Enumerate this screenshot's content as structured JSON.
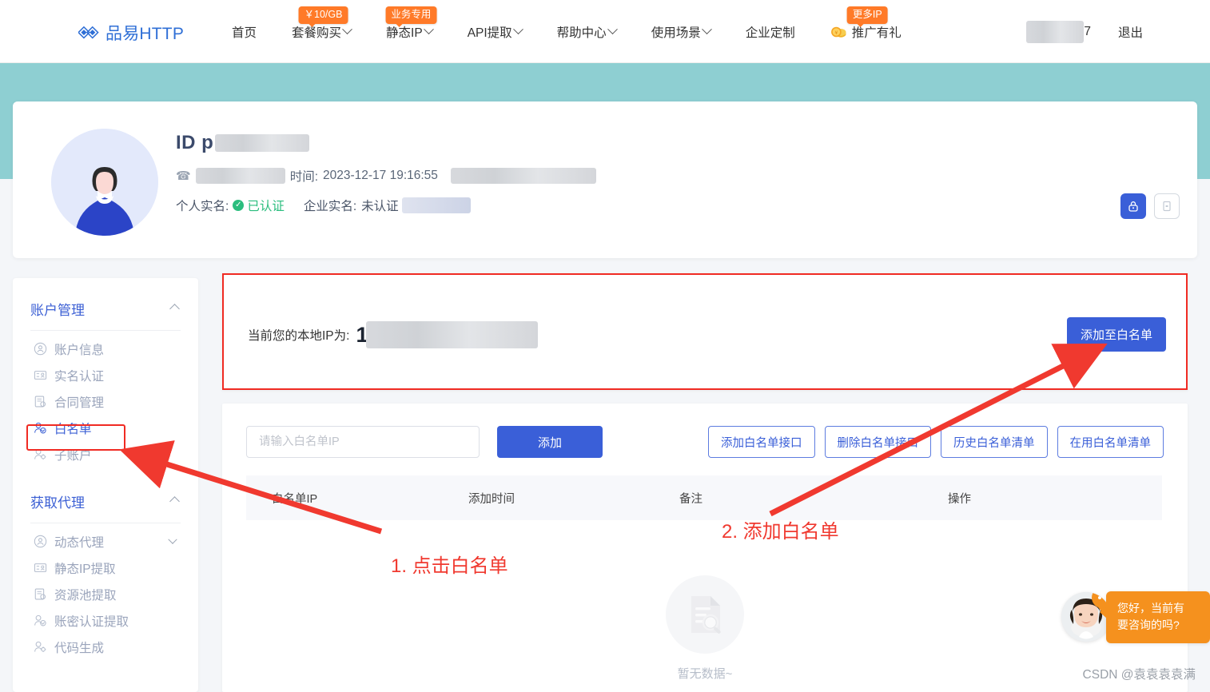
{
  "nav": {
    "logo_text": "品易HTTP",
    "items": [
      {
        "label": "首页",
        "caret": false,
        "badge": null
      },
      {
        "label": "套餐购买",
        "caret": true,
        "badge": "￥10/GB"
      },
      {
        "label": "静态IP",
        "caret": true,
        "badge": "业务专用"
      },
      {
        "label": "API提取",
        "caret": true,
        "badge": null
      },
      {
        "label": "帮助中心",
        "caret": true,
        "badge": null
      },
      {
        "label": "使用场景",
        "caret": true,
        "badge": null
      },
      {
        "label": "企业定制",
        "caret": false,
        "badge": null
      },
      {
        "label": "推广有礼",
        "caret": false,
        "badge": "更多IP",
        "icon": "coin-icon"
      }
    ],
    "user_suffix": "7",
    "logout_label": "退出"
  },
  "profile": {
    "id_prefix": "ID p",
    "register_label": "时间:",
    "register_time": "2023-12-17 19:16:55",
    "personal_label": "个人实名:",
    "personal_status": "已认证",
    "company_label": "企业实名:",
    "company_status": "未认证",
    "action_lock_icon": "lock-icon",
    "action_device_icon": "device-icon"
  },
  "sidebar": {
    "groups": [
      {
        "title": "账户管理",
        "collapse_icon": "chevron-up-icon",
        "items": [
          {
            "label": "账户信息",
            "icon": "user-circle-icon",
            "active": false,
            "sub": false
          },
          {
            "label": "实名认证",
            "icon": "id-card-icon",
            "active": false,
            "sub": false
          },
          {
            "label": "合同管理",
            "icon": "contract-icon",
            "active": false,
            "sub": false
          },
          {
            "label": "白名单",
            "icon": "user-check-icon",
            "active": true,
            "sub": false
          },
          {
            "label": "子账户",
            "icon": "user-gear-icon",
            "active": false,
            "sub": false
          }
        ]
      },
      {
        "title": "获取代理",
        "collapse_icon": "chevron-up-icon",
        "items": [
          {
            "label": "动态代理",
            "icon": "user-circle-icon",
            "active": false,
            "sub": true
          },
          {
            "label": "静态IP提取",
            "icon": "id-card-icon",
            "active": false,
            "sub": false
          },
          {
            "label": "资源池提取",
            "icon": "contract-icon",
            "active": false,
            "sub": false
          },
          {
            "label": "账密认证提取",
            "icon": "user-check-icon",
            "active": false,
            "sub": false
          },
          {
            "label": "代码生成",
            "icon": "user-gear-icon",
            "active": false,
            "sub": false
          }
        ]
      }
    ]
  },
  "ip_panel": {
    "label": "当前您的本地IP为:",
    "value_visible": "1",
    "add_button": "添加至白名单"
  },
  "whitelist": {
    "input_placeholder": "请输入白名单IP",
    "input_value": "",
    "add_button": "添加",
    "tool_buttons": [
      "添加白名单接口",
      "删除白名单接口",
      "历史白名单清单",
      "在用白名单清单"
    ],
    "columns": [
      "白名单IP",
      "添加时间",
      "备注",
      "操作"
    ],
    "rows": [],
    "empty_text": "暂无数据~"
  },
  "annotations": [
    {
      "text": "1. 点击白名单"
    },
    {
      "text": "2. 添加白名单"
    }
  ],
  "chat": {
    "message_line1": "您好，当前有",
    "message_line2": "要咨询的吗?"
  },
  "watermark": "CSDN @袁袁袁袁满",
  "colors": {
    "brand_blue": "#3a5fd8",
    "teal_band": "#8ecfd2",
    "badge_orange": "#ff7a28",
    "annotation_red": "#f0392f",
    "verified_green": "#2bbd7e",
    "chat_orange": "#f5911e"
  }
}
